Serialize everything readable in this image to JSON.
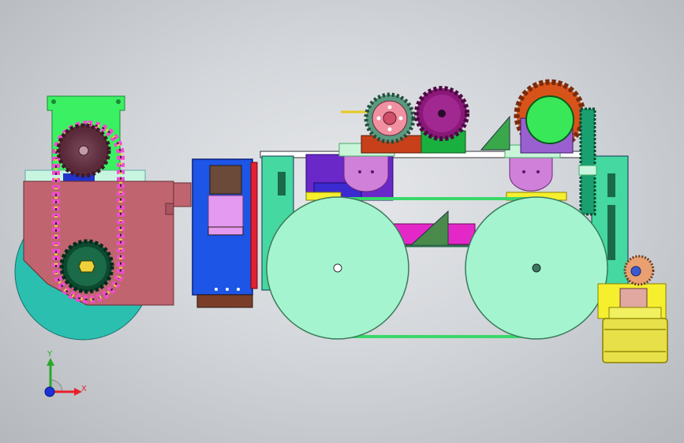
{
  "axis_triad": {
    "x_label": "X",
    "y_label": "Y",
    "x_color": "#e8202a",
    "y_color": "#2aa82a",
    "z_color": "#1a32d8"
  },
  "palette": {
    "chain": "multicolor",
    "wheels": "#a4f5cf",
    "drum": "#2bbfb0",
    "housing": "#c06570",
    "pulley": "#e8e048",
    "gear_orange": "#d8531a",
    "gear_purple": "#8a1878"
  }
}
